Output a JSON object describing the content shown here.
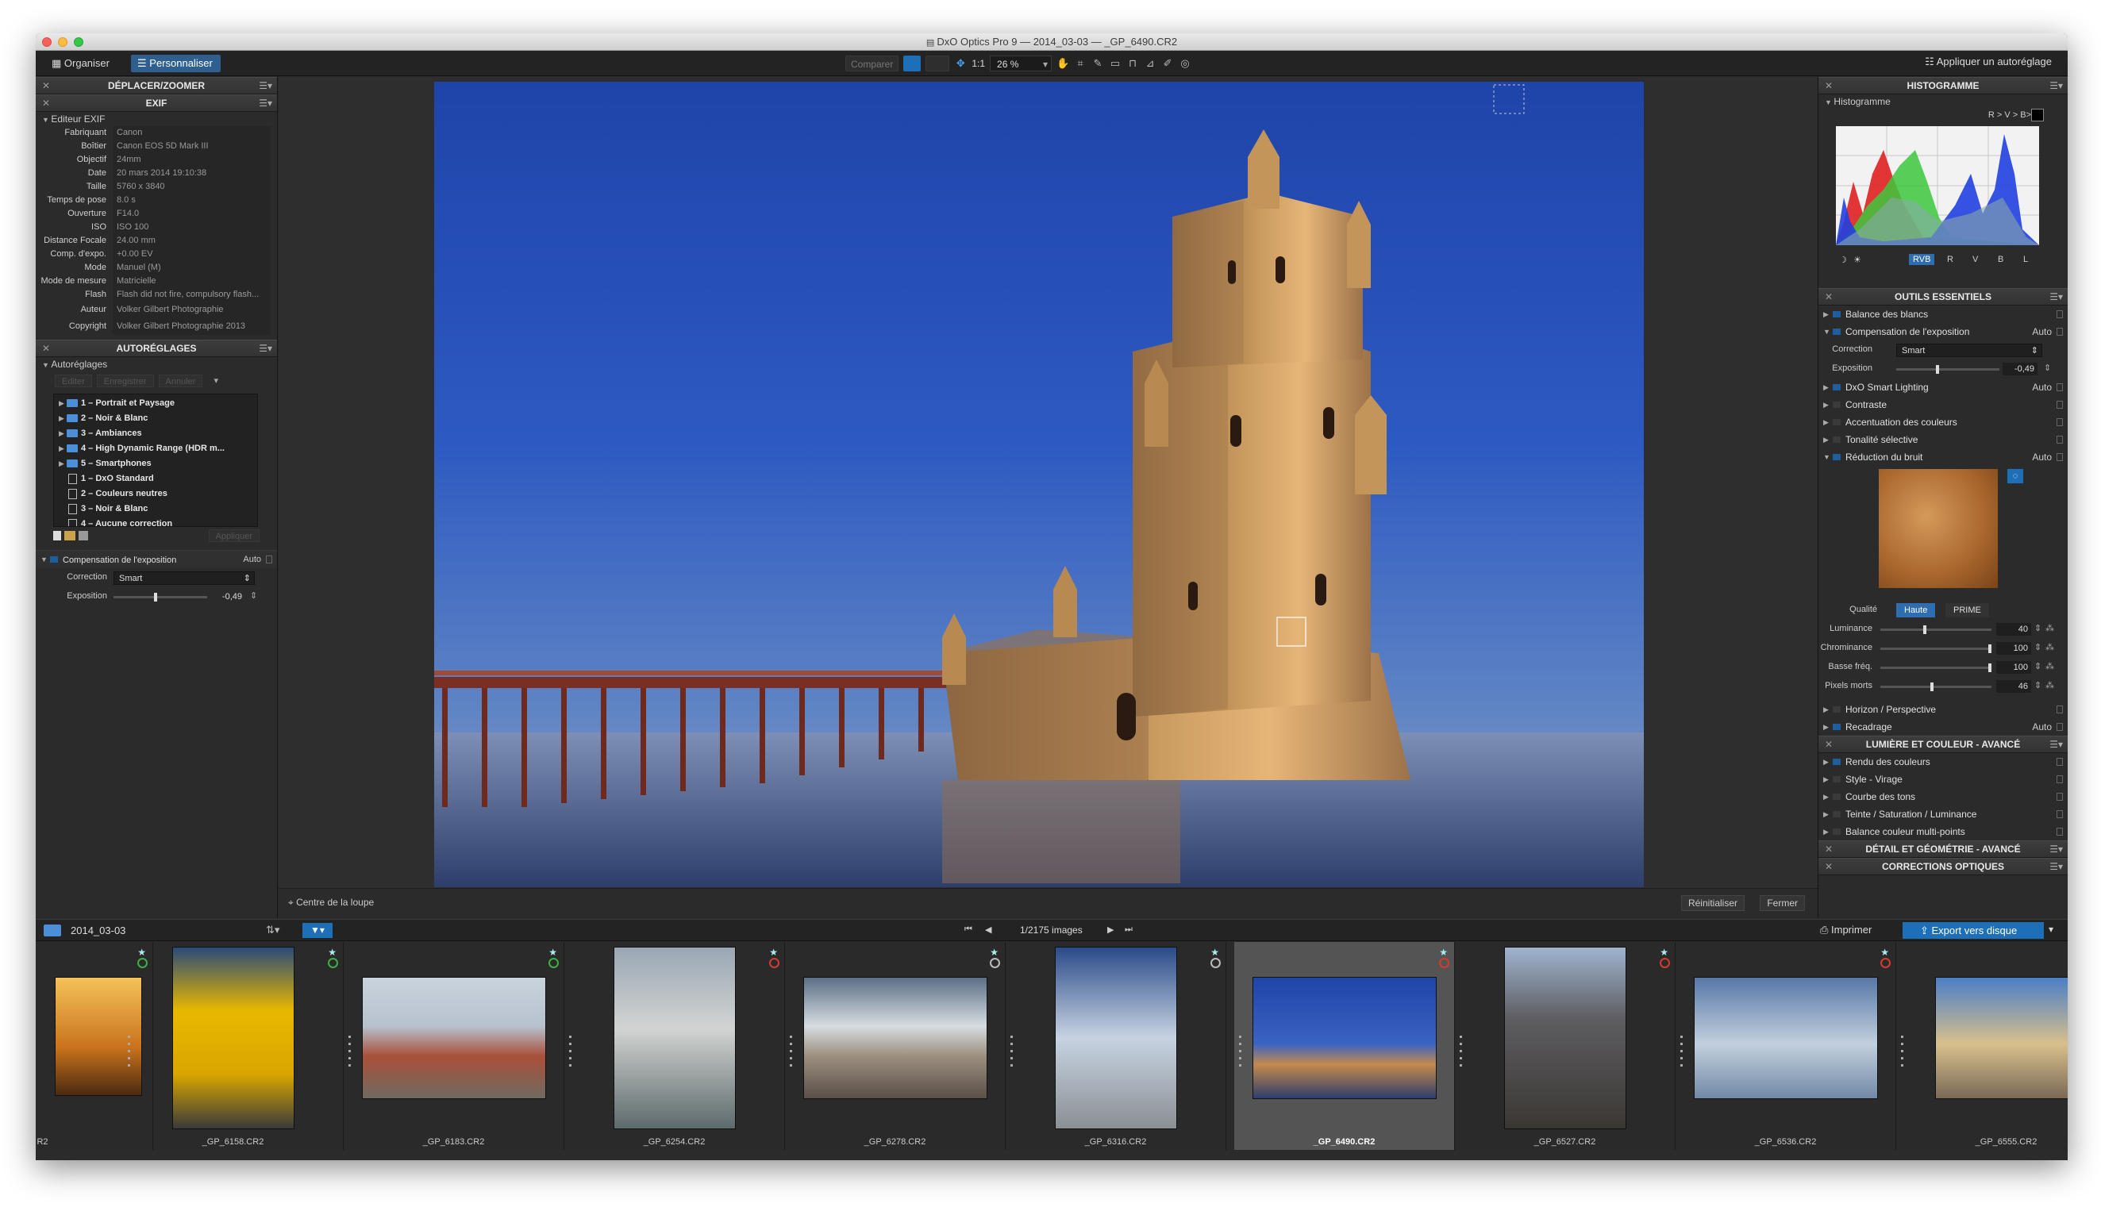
{
  "window": {
    "title": "DxO Optics Pro 9 — 2014_03-03 — _GP_6490.CR2"
  },
  "toolbar": {
    "organiser_label": "Organiser",
    "personnaliser_label": "Personnaliser",
    "compare_label": "Comparer",
    "one_to_one_label": "1:1",
    "zoom_value": "26 %",
    "autoreglage_label": "Appliquer un autoréglage"
  },
  "left": {
    "deplacer_title": "DÉPLACER/ZOOMER",
    "exif_title": "EXIF",
    "exif_editor_label": "Editeur EXIF",
    "exif": [
      {
        "k": "Fabriquant",
        "v": "Canon"
      },
      {
        "k": "Boîtier",
        "v": "Canon EOS 5D Mark III"
      },
      {
        "k": "Objectif",
        "v": "24mm"
      },
      {
        "k": "Date",
        "v": "20 mars 2014 19:10:38"
      },
      {
        "k": "Taille",
        "v": "5760 x 3840"
      },
      {
        "k": "Temps de pose",
        "v": "8.0 s"
      },
      {
        "k": "Ouverture",
        "v": "F14.0"
      },
      {
        "k": "ISO",
        "v": "ISO 100"
      },
      {
        "k": "Distance Focale",
        "v": "24.00 mm"
      },
      {
        "k": "Comp. d'expo.",
        "v": "+0.00 EV"
      },
      {
        "k": "Mode",
        "v": "Manuel (M)"
      },
      {
        "k": "Mode de mesure",
        "v": "Matricielle"
      },
      {
        "k": "Flash",
        "v": "Flash did not fire, compulsory flash..."
      },
      {
        "k": "Auteur",
        "v": "Volker Gilbert Photographie"
      },
      {
        "k": "Copyright",
        "v": "Volker Gilbert Photographie 2013"
      }
    ],
    "autoreglages_title": "AUTORÉGLAGES",
    "autoreglages_label": "Autoréglages",
    "preset_buttons": [
      "Editer",
      "Enregistrer",
      "Annuler"
    ],
    "presets": [
      {
        "label": "1 – Portrait et Paysage",
        "kind": "folder"
      },
      {
        "label": "2 – Noir & Blanc",
        "kind": "folder"
      },
      {
        "label": "3 – Ambiances",
        "kind": "folder"
      },
      {
        "label": "4 – High Dynamic Range (HDR m...",
        "kind": "folder"
      },
      {
        "label": "5 – Smartphones",
        "kind": "folder"
      },
      {
        "label": "1 – DxO Standard",
        "kind": "doc"
      },
      {
        "label": "2 – Couleurs neutres",
        "kind": "doc"
      },
      {
        "label": "3 – Noir & Blanc",
        "kind": "doc"
      },
      {
        "label": "4 – Aucune correction",
        "kind": "doc"
      }
    ],
    "apply_label": "Appliquer",
    "expo_title": "Compensation de l'exposition",
    "expo_auto": "Auto",
    "correction_label": "Correction",
    "correction_value": "Smart",
    "exposition_label": "Exposition",
    "exposition_value": "-0,49"
  },
  "viewer": {
    "loupe_label": "Centre de la loupe",
    "reset_label": "Réinitialiser",
    "close_label": "Fermer"
  },
  "right": {
    "histo_title": "HISTOGRAMME",
    "histo_label": "Histogramme",
    "histo_order": "R > V > B>",
    "channels": [
      "RVB",
      "R",
      "V",
      "B",
      "L"
    ],
    "essentials_title": "OUTILS ESSENTIELS",
    "tools": [
      {
        "label": "Balance des blancs",
        "auto": "",
        "on": true,
        "open": false
      },
      {
        "label": "Compensation de l'exposition",
        "auto": "Auto",
        "on": true,
        "open": true
      }
    ],
    "correction_label": "Correction",
    "correction_value": "Smart",
    "exposition_label": "Exposition",
    "exposition_value": "-0,49",
    "tools2": [
      {
        "label": "DxO Smart Lighting",
        "auto": "Auto",
        "on": true
      },
      {
        "label": "Contraste",
        "auto": "",
        "on": false
      },
      {
        "label": "Accentuation des couleurs",
        "auto": "",
        "on": false
      },
      {
        "label": "Tonalité sélective",
        "auto": "",
        "on": false
      },
      {
        "label": "Réduction du bruit",
        "auto": "Auto",
        "on": true
      }
    ],
    "qualite_label": "Qualité",
    "qualite_options": [
      "Haute",
      "PRIME"
    ],
    "noise": [
      {
        "label": "Luminance",
        "value": "40",
        "pos": 0.4
      },
      {
        "label": "Chrominance",
        "value": "100",
        "pos": 1.0
      },
      {
        "label": "Basse fréq.",
        "value": "100",
        "pos": 1.0
      },
      {
        "label": "Pixels morts",
        "value": "46",
        "pos": 0.46
      }
    ],
    "tools3": [
      {
        "label": "Horizon / Perspective",
        "auto": "",
        "on": false
      },
      {
        "label": "Recadrage",
        "auto": "Auto",
        "on": true
      }
    ],
    "lumiere_title": "LUMIÈRE ET COULEUR - AVANCÉ",
    "tools4": [
      {
        "label": "Rendu des couleurs",
        "on": true
      },
      {
        "label": "Style - Virage",
        "on": false
      },
      {
        "label": "Courbe des tons",
        "on": false
      },
      {
        "label": "Teinte / Saturation / Luminance",
        "on": false
      },
      {
        "label": "Balance couleur multi-points",
        "on": false
      }
    ],
    "detail_title": "DÉTAIL ET GÉOMÉTRIE - AVANCÉ",
    "optiques_title": "CORRECTIONS OPTIQUES"
  },
  "strip": {
    "folder": "2014_03-03",
    "count": "1/2175 images",
    "print_label": "Imprimer",
    "export_label": "Export vers disque",
    "thumbs": [
      {
        "name": "R2",
        "status": "green",
        "scene": "sunset"
      },
      {
        "name": "_GP_6158.CR2",
        "status": "green",
        "scene": "tram"
      },
      {
        "name": "_GP_6183.CR2",
        "status": "green",
        "scene": "city"
      },
      {
        "name": "_GP_6254.CR2",
        "status": "red",
        "scene": "reflection"
      },
      {
        "name": "_GP_6278.CR2",
        "status": "grey",
        "scene": "pier"
      },
      {
        "name": "_GP_6316.CR2",
        "status": "grey",
        "scene": "tower"
      },
      {
        "name": "_GP_6490.CR2",
        "status": "red",
        "scene": "belem",
        "selected": true
      },
      {
        "name": "_GP_6527.CR2",
        "status": "red",
        "scene": "street"
      },
      {
        "name": "_GP_6536.CR2",
        "status": "red",
        "scene": "sea"
      },
      {
        "name": "_GP_6555.CR2",
        "status": "none",
        "scene": "square"
      }
    ]
  }
}
